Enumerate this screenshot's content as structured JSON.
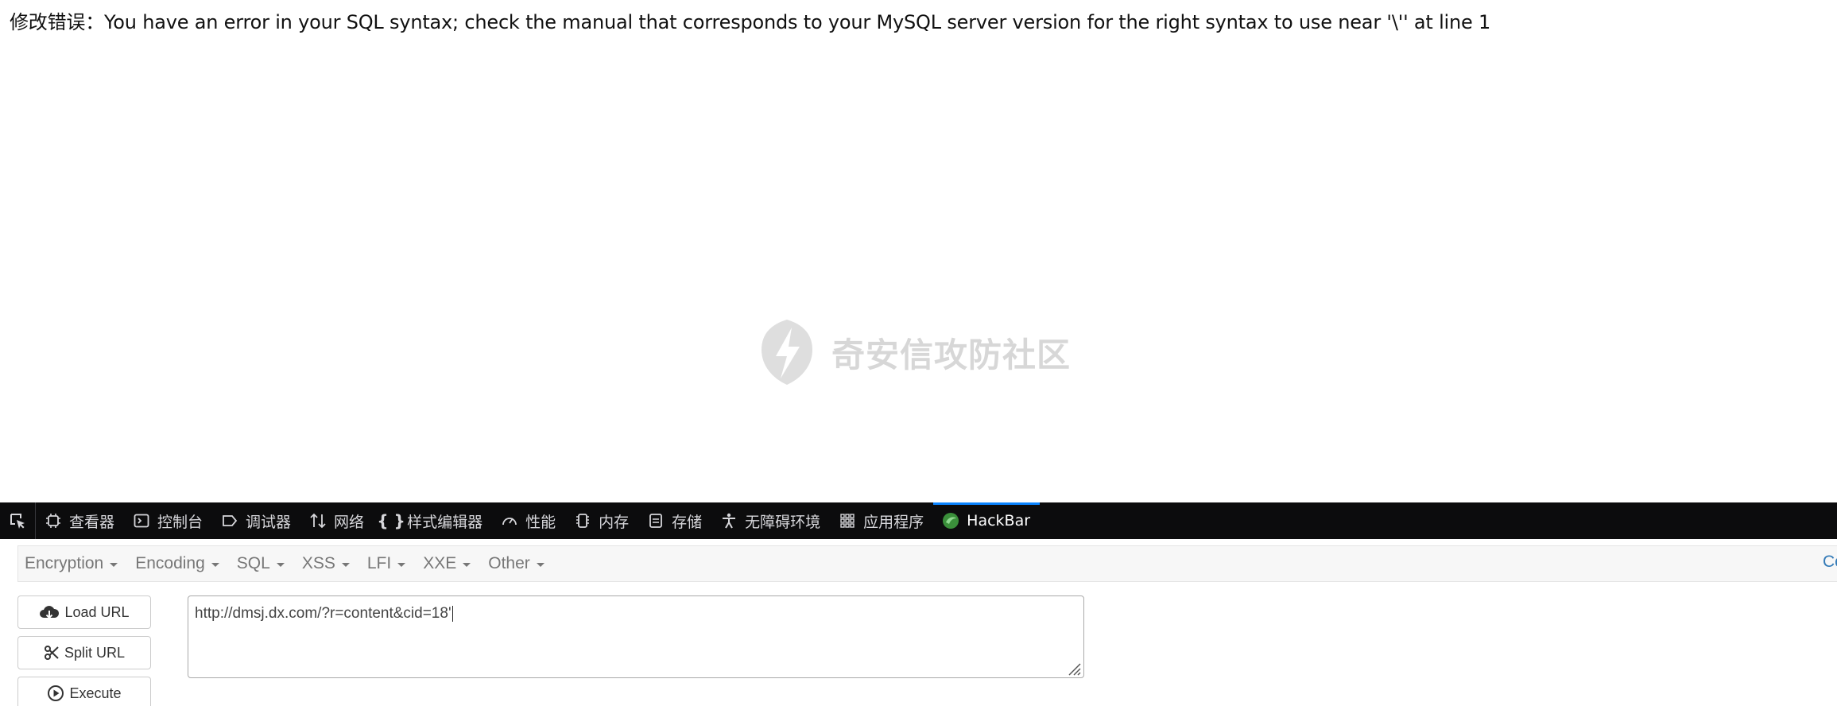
{
  "page": {
    "error_label": "修改错误：",
    "error_message": "You have an error in your SQL syntax; check the manual that corresponds to your MySQL server version for the right syntax to use near '\\'' at line 1"
  },
  "watermark": {
    "text": "奇安信攻防社区"
  },
  "devtools": {
    "tabs": [
      {
        "label": "查看器",
        "icon": "inspector-icon"
      },
      {
        "label": "控制台",
        "icon": "console-icon"
      },
      {
        "label": "调试器",
        "icon": "debugger-icon"
      },
      {
        "label": "网络",
        "icon": "network-icon"
      },
      {
        "label": "样式编辑器",
        "icon": "style-editor-icon"
      },
      {
        "label": "性能",
        "icon": "performance-icon"
      },
      {
        "label": "内存",
        "icon": "memory-icon"
      },
      {
        "label": "存储",
        "icon": "storage-icon"
      },
      {
        "label": "无障碍环境",
        "icon": "accessibility-icon"
      },
      {
        "label": "应用程序",
        "icon": "application-icon"
      },
      {
        "label": "HackBar",
        "icon": "hackbar-icon"
      }
    ],
    "active_tab": "HackBar"
  },
  "hackbar": {
    "menus": [
      "Encryption",
      "Encoding",
      "SQL",
      "XSS",
      "LFI",
      "XXE",
      "Other"
    ],
    "menu_right": "Co",
    "buttons": {
      "load_url": "Load URL",
      "split_url": "Split URL",
      "execute": "Execute"
    },
    "url_value": "http://dmsj.dx.com/?r=content&cid=18'"
  },
  "colors": {
    "devtools_bg": "#0c0c0d",
    "active_tab_accent": "#0a84ff",
    "menubar_bg": "#f7f7f7",
    "link_blue": "#337ab7"
  }
}
